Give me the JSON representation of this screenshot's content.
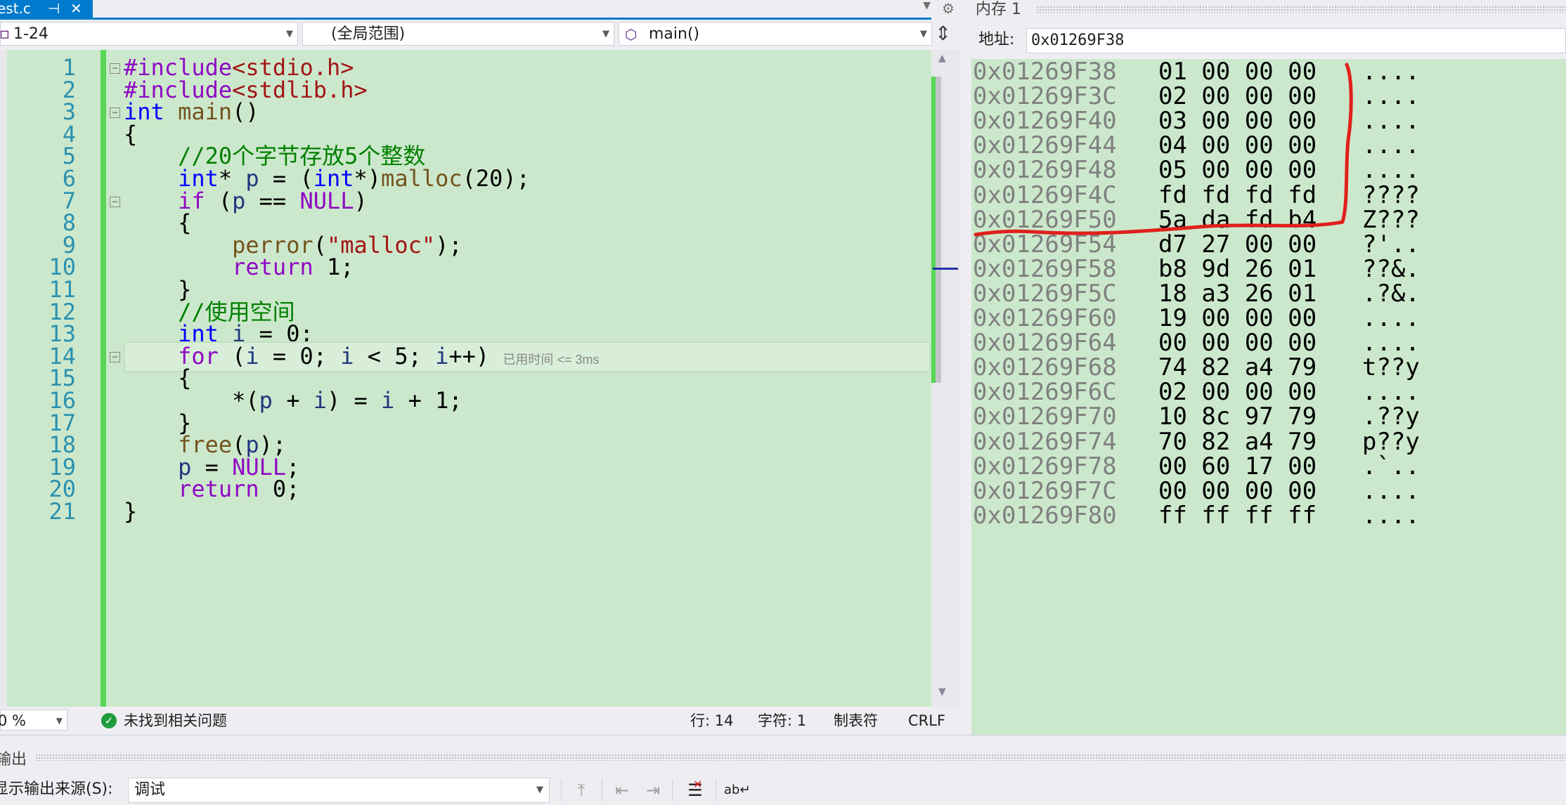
{
  "editor": {
    "tab_label": "est.c",
    "tab_pin": "⊣",
    "tab_close": "✕",
    "nav": {
      "project": "1-24",
      "scope": "(全局范围)",
      "member": "main()"
    },
    "lines": [
      {
        "n": "1",
        "tokens": [
          {
            "t": "#include",
            "c": "mac"
          },
          {
            "t": "<stdio.h>",
            "c": "inc"
          }
        ]
      },
      {
        "n": "2",
        "tokens": [
          {
            "t": "#include",
            "c": "mac"
          },
          {
            "t": "<stdlib.h>",
            "c": "inc"
          }
        ]
      },
      {
        "n": "3",
        "tokens": [
          {
            "t": "int",
            "c": "kw"
          },
          {
            "t": " "
          },
          {
            "t": "main",
            "c": "fn"
          },
          {
            "t": "()"
          }
        ]
      },
      {
        "n": "4",
        "tokens": [
          {
            "t": "{"
          }
        ]
      },
      {
        "n": "5",
        "tokens": [
          {
            "t": "    "
          },
          {
            "t": "//20个字节存放5个整数",
            "c": "cm"
          }
        ]
      },
      {
        "n": "6",
        "tokens": [
          {
            "t": "    "
          },
          {
            "t": "int",
            "c": "kw"
          },
          {
            "t": "* "
          },
          {
            "t": "p",
            "c": "var"
          },
          {
            "t": " = ("
          },
          {
            "t": "int",
            "c": "kw"
          },
          {
            "t": "*)"
          },
          {
            "t": "malloc",
            "c": "fn"
          },
          {
            "t": "(20);"
          }
        ]
      },
      {
        "n": "7",
        "tokens": [
          {
            "t": "    "
          },
          {
            "t": "if",
            "c": "ctl"
          },
          {
            "t": " ("
          },
          {
            "t": "p",
            "c": "var"
          },
          {
            "t": " == "
          },
          {
            "t": "NULL",
            "c": "mac"
          },
          {
            "t": ")"
          }
        ]
      },
      {
        "n": "8",
        "tokens": [
          {
            "t": "    {"
          }
        ]
      },
      {
        "n": "9",
        "tokens": [
          {
            "t": "        "
          },
          {
            "t": "perror",
            "c": "fn"
          },
          {
            "t": "("
          },
          {
            "t": "\"malloc\"",
            "c": "str"
          },
          {
            "t": ");"
          }
        ]
      },
      {
        "n": "10",
        "tokens": [
          {
            "t": "        "
          },
          {
            "t": "return",
            "c": "ctl"
          },
          {
            "t": " 1;"
          }
        ]
      },
      {
        "n": "11",
        "tokens": [
          {
            "t": "    }"
          }
        ]
      },
      {
        "n": "12",
        "tokens": [
          {
            "t": "    "
          },
          {
            "t": "//使用空间",
            "c": "cm"
          }
        ]
      },
      {
        "n": "13",
        "tokens": [
          {
            "t": "    "
          },
          {
            "t": "int",
            "c": "kw"
          },
          {
            "t": " "
          },
          {
            "t": "i",
            "c": "var"
          },
          {
            "t": " = 0;"
          }
        ]
      },
      {
        "n": "14",
        "tokens": [
          {
            "t": "    "
          },
          {
            "t": "for",
            "c": "ctl"
          },
          {
            "t": " ("
          },
          {
            "t": "i",
            "c": "var"
          },
          {
            "t": " = 0; "
          },
          {
            "t": "i",
            "c": "var"
          },
          {
            "t": " < 5; "
          },
          {
            "t": "i",
            "c": "var"
          },
          {
            "t": "++) "
          }
        ],
        "hint": "已用时间 <= 3ms"
      },
      {
        "n": "15",
        "tokens": [
          {
            "t": "    {"
          }
        ]
      },
      {
        "n": "16",
        "tokens": [
          {
            "t": "        *("
          },
          {
            "t": "p",
            "c": "var"
          },
          {
            "t": " + "
          },
          {
            "t": "i",
            "c": "var"
          },
          {
            "t": ") = "
          },
          {
            "t": "i",
            "c": "var"
          },
          {
            "t": " + 1;"
          }
        ]
      },
      {
        "n": "17",
        "tokens": [
          {
            "t": "    }"
          }
        ]
      },
      {
        "n": "18",
        "tokens": [
          {
            "t": "    "
          },
          {
            "t": "free",
            "c": "fn"
          },
          {
            "t": "("
          },
          {
            "t": "p",
            "c": "var"
          },
          {
            "t": ");"
          }
        ]
      },
      {
        "n": "19",
        "tokens": [
          {
            "t": "    "
          },
          {
            "t": "p",
            "c": "var"
          },
          {
            "t": " = "
          },
          {
            "t": "NULL",
            "c": "mac"
          },
          {
            "t": ";"
          }
        ]
      },
      {
        "n": "20",
        "tokens": [
          {
            "t": "    "
          },
          {
            "t": "return",
            "c": "ctl"
          },
          {
            "t": " 0;"
          }
        ]
      },
      {
        "n": "21",
        "tokens": [
          {
            "t": "}"
          }
        ]
      }
    ],
    "status": {
      "zoom": "0 %",
      "issues": "未找到相关问题",
      "line": "行: 14",
      "char": "字符: 1",
      "indent": "制表符",
      "eol": "CRLF"
    }
  },
  "memory": {
    "title": "内存 1",
    "address_label": "地址:",
    "address_value": "0x01269F38",
    "rows": [
      {
        "addr": "0x01269F38",
        "bytes": "01 00 00 00",
        "ascii": "...."
      },
      {
        "addr": "0x01269F3C",
        "bytes": "02 00 00 00",
        "ascii": "...."
      },
      {
        "addr": "0x01269F40",
        "bytes": "03 00 00 00",
        "ascii": "...."
      },
      {
        "addr": "0x01269F44",
        "bytes": "04 00 00 00",
        "ascii": "...."
      },
      {
        "addr": "0x01269F48",
        "bytes": "05 00 00 00",
        "ascii": "...."
      },
      {
        "addr": "0x01269F4C",
        "bytes": "fd fd fd fd",
        "ascii": "????"
      },
      {
        "addr": "0x01269F50",
        "bytes": "5a da fd b4",
        "ascii": "Z???"
      },
      {
        "addr": "0x01269F54",
        "bytes": "d7 27 00 00",
        "ascii": "?'.."
      },
      {
        "addr": "0x01269F58",
        "bytes": "b8 9d 26 01",
        "ascii": "??&."
      },
      {
        "addr": "0x01269F5C",
        "bytes": "18 a3 26 01",
        "ascii": ".?&."
      },
      {
        "addr": "0x01269F60",
        "bytes": "19 00 00 00",
        "ascii": "...."
      },
      {
        "addr": "0x01269F64",
        "bytes": "00 00 00 00",
        "ascii": "...."
      },
      {
        "addr": "0x01269F68",
        "bytes": "74 82 a4 79",
        "ascii": "t??y"
      },
      {
        "addr": "0x01269F6C",
        "bytes": "02 00 00 00",
        "ascii": "...."
      },
      {
        "addr": "0x01269F70",
        "bytes": "10 8c 97 79",
        "ascii": ".??y"
      },
      {
        "addr": "0x01269F74",
        "bytes": "70 82 a4 79",
        "ascii": "p??y"
      },
      {
        "addr": "0x01269F78",
        "bytes": "00 60 17 00",
        "ascii": ".`.."
      },
      {
        "addr": "0x01269F7C",
        "bytes": "00 00 00 00",
        "ascii": "...."
      },
      {
        "addr": "0x01269F80",
        "bytes": "ff ff ff ff",
        "ascii": "...."
      }
    ]
  },
  "output": {
    "title": "输出",
    "source_label": "显示输出来源(S):",
    "source_value": "调试"
  },
  "colors": {
    "code_bg": "#cce8cc",
    "accent": "#007acc",
    "annotation": "#e0201c"
  }
}
